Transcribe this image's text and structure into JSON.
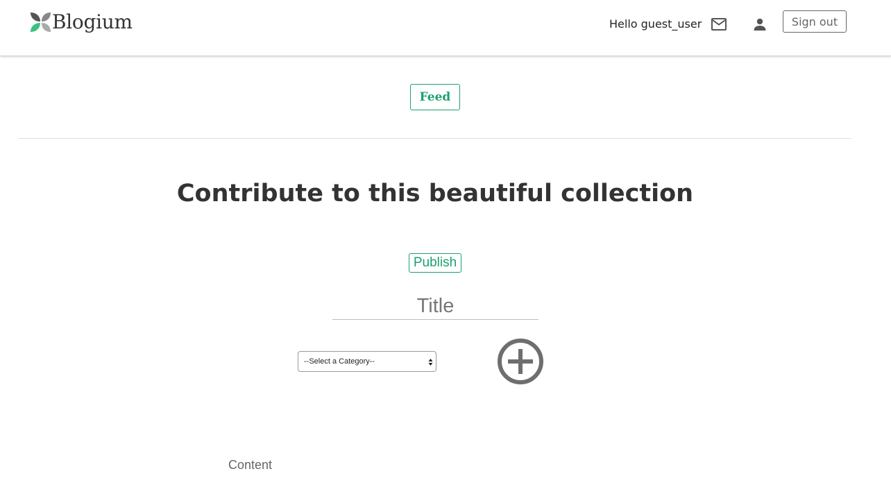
{
  "navbar": {
    "brand_name": "Blogium",
    "greeting": "Hello guest_user",
    "signout_label": "Sign out",
    "icons": {
      "mail": "mail-outline-icon",
      "user": "person-icon",
      "logo": "leaf-logo-icon"
    }
  },
  "feed": {
    "label": "Feed"
  },
  "main": {
    "heading": "Contribute to this beautiful collection",
    "publish_label": "Publish",
    "title_placeholder": "Title",
    "category_selected": "--Select a Category--",
    "add_icon": "plus-circle-icon",
    "content_label": "Content"
  },
  "colors": {
    "accent": "#1aa16e",
    "text": "#333333",
    "muted": "#666666"
  }
}
